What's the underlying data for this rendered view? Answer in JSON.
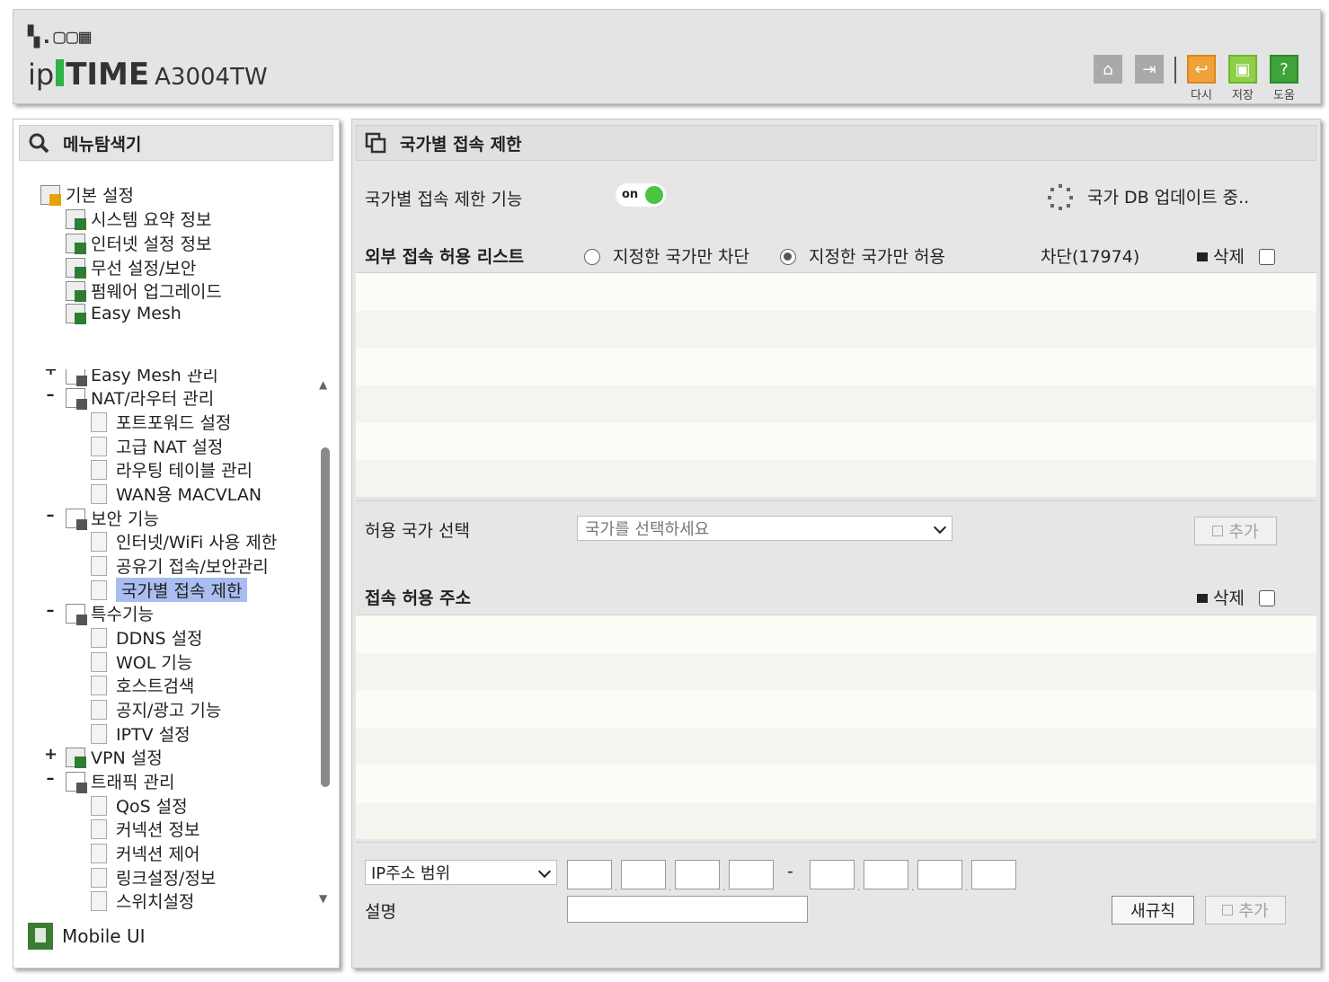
{
  "header": {
    "logo_dots": "▚.▢▢▦",
    "logo_ip": "ip",
    "logo_time": "TIME",
    "model": "A3004TW",
    "buttons": [
      {
        "icon": "home-icon",
        "label": ""
      },
      {
        "icon": "logout-icon",
        "label": ""
      },
      {
        "icon": "reload-icon",
        "label": "다시"
      },
      {
        "icon": "save-icon",
        "label": "저장"
      },
      {
        "icon": "help-icon",
        "label": "도움"
      }
    ]
  },
  "sidebar": {
    "title": "메뉴탐색기",
    "basic": {
      "label": "기본 설정",
      "items": [
        "시스템 요약 정보",
        "인터넷 설정 정보",
        "무선 설정/보안",
        "펌웨어 업그레이드",
        "Easy Mesh"
      ]
    },
    "tree": {
      "easy_mesh_mgmt": "Easy Mesh 관리",
      "nat": "NAT/라우터 관리",
      "nat_items": [
        "포트포워드 설정",
        "고급 NAT 설정",
        "라우팅 테이블 관리",
        "WAN용 MACVLAN"
      ],
      "security": "보안 기능",
      "security_items": [
        "인터넷/WiFi 사용 제한",
        "공유기 접속/보안관리",
        "국가별 접속 제한"
      ],
      "special": "특수기능",
      "special_items": [
        "DDNS 설정",
        "WOL 기능",
        "호스트검색",
        "공지/광고 기능",
        "IPTV 설정"
      ],
      "vpn": "VPN 설정",
      "traffic": "트래픽 관리",
      "traffic_items": [
        "QoS 설정",
        "커넥션 정보",
        "커넥션 제어",
        "링크설정/정보",
        "스위치설정"
      ]
    },
    "mobile_label": "Mobile UI"
  },
  "main": {
    "title": "국가별 접속 제한",
    "feature_label": "국가별 접속 제한 기능",
    "toggle_text": "on",
    "db_status": "국가 DB 업데이트 중..",
    "list_header": "외부 접속 허용 리스트",
    "radio_block": "지정한 국가만 차단",
    "radio_allow": "지정한 국가만 허용",
    "blocked_count": "차단(17974)",
    "delete_label": "삭제",
    "country_select_label": "허용 국가 선택",
    "country_select_placeholder": "국가를 선택하세요",
    "add_label": "추가",
    "access_address_header": "접속 허용 주소",
    "ip_mode_select": "IP주소 범위",
    "range_dash": "-",
    "description_label": "설명",
    "new_rule_button": "새규칙"
  }
}
